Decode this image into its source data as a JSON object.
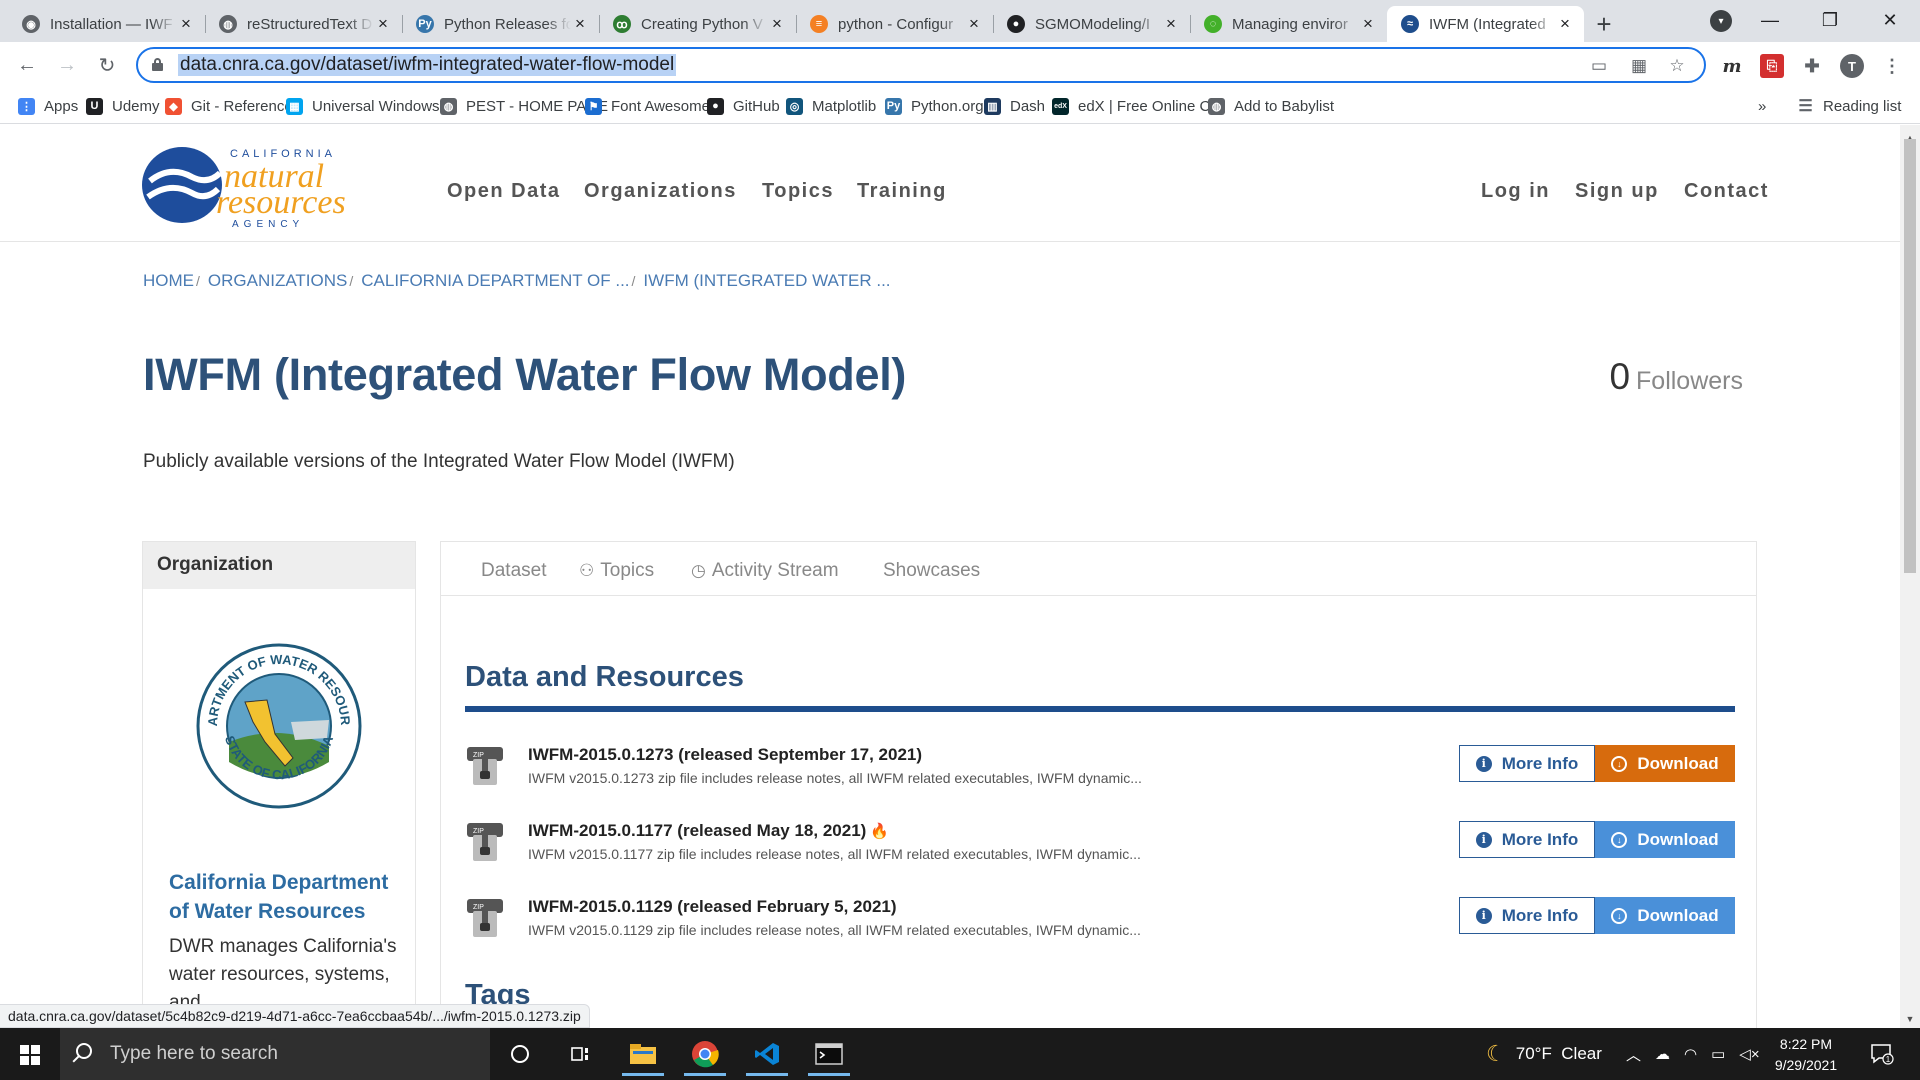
{
  "browser": {
    "tabs": [
      {
        "title": "Installation — IWF",
        "color": "#5f6368",
        "glyph": "◉"
      },
      {
        "title": "reStructuredText D",
        "color": "#5f6368",
        "glyph": "◍"
      },
      {
        "title": "Python Releases fo",
        "color": "#3776ab",
        "glyph": "Py"
      },
      {
        "title": "Creating Python V",
        "color": "#2e7d32",
        "glyph": "ꝏ"
      },
      {
        "title": "python - Configur",
        "color": "#f48024",
        "glyph": "≡"
      },
      {
        "title": "SGMOModeling/I",
        "color": "#202124",
        "glyph": "●"
      },
      {
        "title": "Managing enviror",
        "color": "#43b02a",
        "glyph": "◌"
      },
      {
        "title": "IWFM (Integrated",
        "color": "#1e4d8c",
        "glyph": "≈"
      }
    ],
    "new_tab": "+",
    "window_controls": {
      "minimize": "—",
      "maximize": "❐",
      "close": "✕"
    },
    "url": "data.cnra.ca.gov/dataset/iwfm-integrated-water-flow-model",
    "profile_initial": "T",
    "bookmarks": [
      {
        "label": "Apps",
        "color": "#4285f4",
        "glyph": "⋮"
      },
      {
        "label": "Udemy",
        "color": "#202124",
        "glyph": "U"
      },
      {
        "label": "Git - Reference",
        "color": "#f05133",
        "glyph": "◆"
      },
      {
        "label": "Universal Windows...",
        "color": "#00a4ef",
        "glyph": "▦"
      },
      {
        "label": "PEST - HOME PAGE",
        "color": "#5f6368",
        "glyph": "◍"
      },
      {
        "label": "Font Awesome",
        "color": "#1c6dd0",
        "glyph": "⚑"
      },
      {
        "label": "GitHub",
        "color": "#202124",
        "glyph": "●"
      },
      {
        "label": "Matplotlib",
        "color": "#11557c",
        "glyph": "◎"
      },
      {
        "label": "Python.org",
        "color": "#3776ab",
        "glyph": "Py"
      },
      {
        "label": "Dash",
        "color": "#1e3a5f",
        "glyph": "▥"
      },
      {
        "label": "edX | Free Online C...",
        "color": "#02262b",
        "glyph": "edX"
      },
      {
        "label": "Add to Babylist",
        "color": "#5f6368",
        "glyph": "◍"
      }
    ],
    "bookmarks_overflow": "»",
    "reading_list": "Reading list"
  },
  "site": {
    "logo_top": "CALIFORNIA",
    "logo_main_1": "natural",
    "logo_main_2": "resources",
    "logo_bottom": "AGENCY",
    "nav": [
      "Open Data",
      "Organizations",
      "Topics",
      "Training"
    ],
    "nav_right": [
      "Log in",
      "Sign up",
      "Contact"
    ]
  },
  "breadcrumbs": [
    "HOME",
    "ORGANIZATIONS",
    "CALIFORNIA DEPARTMENT OF ...",
    "IWFM (INTEGRATED WATER ..."
  ],
  "dataset": {
    "title": "IWFM (Integrated Water Flow Model)",
    "followers_count": "0",
    "followers_label": "Followers",
    "description": "Publicly available versions of the Integrated Water Flow Model (IWFM)"
  },
  "sidebar": {
    "heading": "Organization",
    "seal_text_top": "DEPARTMENT OF WATER RESOURCES",
    "seal_text_bottom": "STATE OF CALIFORNIA",
    "org_name": "California Department of Water Resources",
    "org_desc": "DWR manages California's water resources, systems, and"
  },
  "panel": {
    "tabs": [
      {
        "label": "Dataset",
        "icon": ""
      },
      {
        "label": "Topics",
        "icon": "users-icon"
      },
      {
        "label": "Activity Stream",
        "icon": "clock-icon"
      },
      {
        "label": "Showcases",
        "icon": ""
      }
    ],
    "section_title": "Data and Resources",
    "resources": [
      {
        "title": "IWFM-2015.0.1273 (released September 17, 2021)",
        "desc": "IWFM v2015.0.1273 zip file includes release notes, all IWFM related executables, IWFM dynamic...",
        "flame": false,
        "hover": true
      },
      {
        "title": "IWFM-2015.0.1177 (released May 18, 2021)",
        "desc": "IWFM v2015.0.1177 zip file includes release notes, all IWFM related executables, IWFM dynamic...",
        "flame": true,
        "hover": false
      },
      {
        "title": "IWFM-2015.0.1129 (released February 5, 2021)",
        "desc": "IWFM v2015.0.1129 zip file includes release notes, all IWFM related executables, IWFM dynamic...",
        "flame": false,
        "hover": false
      }
    ],
    "more_info_label": "More Info",
    "download_label": "Download",
    "tags_title": "Tags",
    "zip_label": "ZIP"
  },
  "status_url": "data.cnra.ca.gov/dataset/5c4b82c9-d219-4d71-a6cc-7ea6ccbaa54b/.../iwfm-2015.0.1273.zip",
  "taskbar": {
    "search_placeholder": "Type here to search",
    "weather": "70°F  Clear",
    "time": "8:22 PM",
    "date": "9/29/2021",
    "notification_count": "1"
  },
  "colors": {
    "brand_blue": "#2d5179",
    "download_blue": "#4a90d9",
    "download_hover": "#d76b0d",
    "link": "#4a7bb3"
  }
}
